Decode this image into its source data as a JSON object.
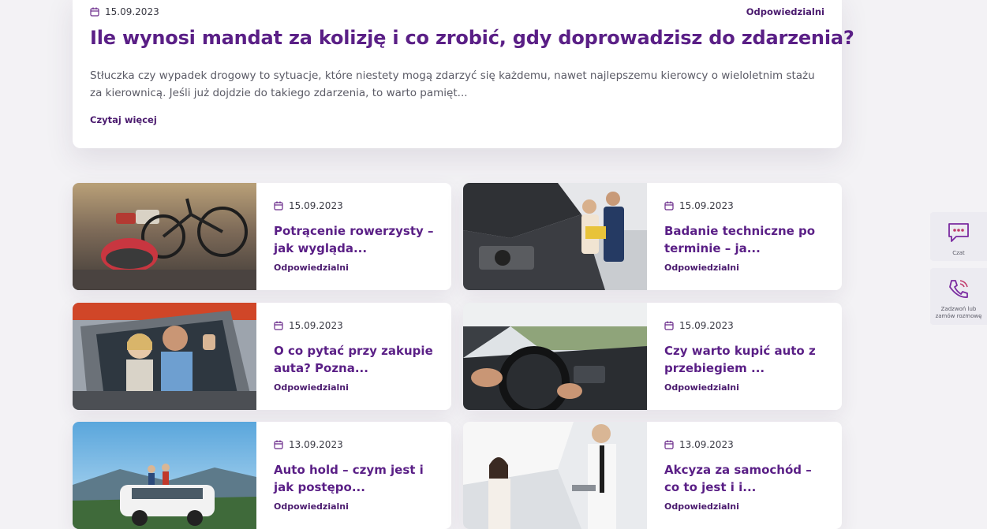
{
  "featured": {
    "date": "15.09.2023",
    "category": "Odpowiedzialni",
    "title": "Ile wynosi mandat za kolizję i co zrobić, gdy doprowadzisz do zdarzenia?",
    "excerpt": "Stłuczka czy wypadek drogowy to sytuacje, które niestety mogą zdarzyć się każdemu, nawet najlepszemu kierowcy o wieloletnim stażu za kierownicą. Jeśli już dojdzie do takiego zdarzenia, to warto pamięt...",
    "read_more": "Czytaj więcej"
  },
  "cards": [
    {
      "date": "15.09.2023",
      "title": "Potrącenie rowerzysty – jak wygląda...",
      "category": "Odpowiedzialni"
    },
    {
      "date": "15.09.2023",
      "title": "Badanie techniczne po terminie – ja...",
      "category": "Odpowiedzialni"
    },
    {
      "date": "15.09.2023",
      "title": "O co pytać przy zakupie auta? Pozna...",
      "category": "Odpowiedzialni"
    },
    {
      "date": "15.09.2023",
      "title": "Czy warto kupić auto z przebiegiem ...",
      "category": "Odpowiedzialni"
    },
    {
      "date": "13.09.2023",
      "title": "Auto hold – czym jest i jak postępo...",
      "category": "Odpowiedzialni"
    },
    {
      "date": "13.09.2023",
      "title": "Akcyza za samochód – co to jest i i...",
      "category": "Odpowiedzialni"
    }
  ],
  "sidebar": {
    "chat_label": "Czat",
    "call_label": "Zadzwoń lub zamów rozmowę"
  },
  "icons": {
    "date": "calendar-icon",
    "chat": "chat-bubble-icon",
    "call": "phone-icon"
  },
  "colors": {
    "title": "#5a1f86",
    "category": "#4a1a6e",
    "background": "#f3f2f5",
    "icon_accent": "#7a2aa0"
  }
}
